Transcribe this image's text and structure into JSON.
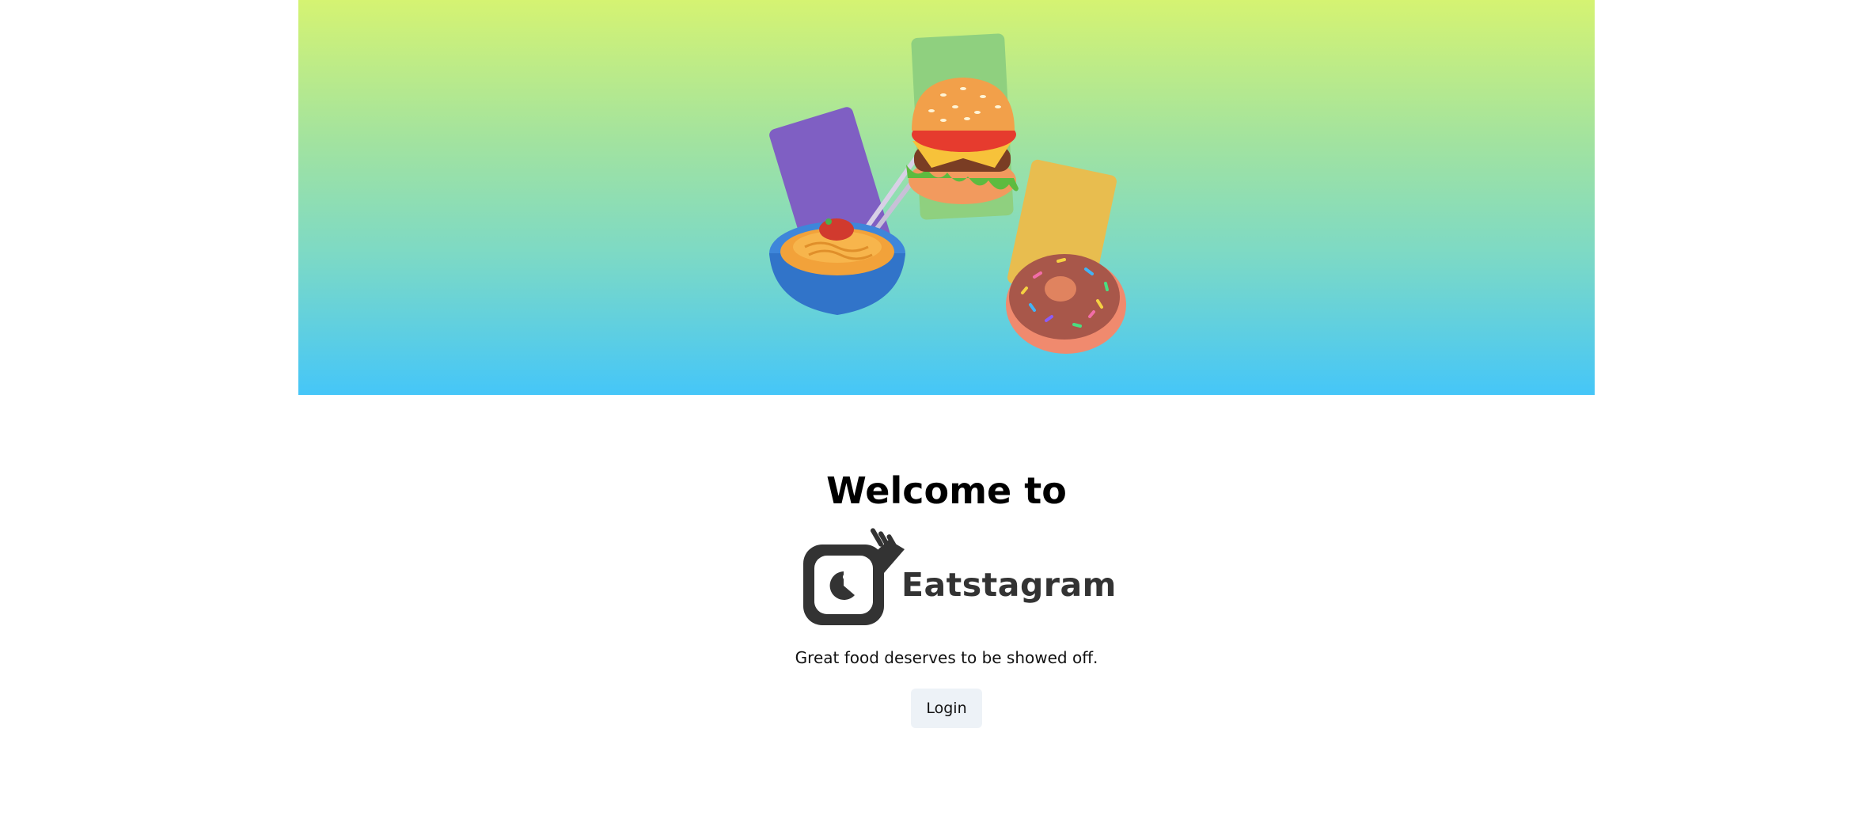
{
  "hero": {
    "illustration": "food-illustration",
    "colors": {
      "gradient_top": "#d5f372",
      "gradient_bottom": "#45c6f8",
      "card_purple": "#7f5fc3",
      "card_green": "#8fd07f",
      "card_yellow": "#e8bd4f"
    }
  },
  "welcome": {
    "title": "Welcome to"
  },
  "brand": {
    "name": "Eatstagram",
    "logo_icon": "camera-fork-icon",
    "color": "#333333"
  },
  "tagline": "Great food deserves to be showed off.",
  "actions": {
    "login_label": "Login"
  }
}
